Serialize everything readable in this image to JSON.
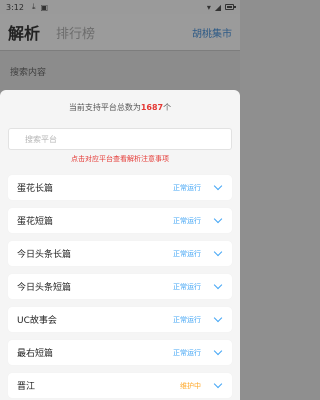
{
  "status_bar": {
    "time": "3:12"
  },
  "background": {
    "tabs": [
      "解析",
      "排行榜"
    ],
    "link_label": "胡桃集市",
    "search_label": "搜索内容"
  },
  "sheet": {
    "count_prefix": "当前支持平台总数为",
    "count_value": "1687",
    "count_suffix": "个",
    "search_placeholder": "搜索平台",
    "notice": "点击对应平台查看解析注意事项",
    "platforms": [
      {
        "name": "蛋花长篇",
        "status": "正常运行"
      },
      {
        "name": "蛋花短篇",
        "status": "正常运行"
      },
      {
        "name": "今日头条长篇",
        "status": "正常运行"
      },
      {
        "name": "今日头条短篇",
        "status": "正常运行"
      },
      {
        "name": "UC故事会",
        "status": "正常运行"
      },
      {
        "name": "最右短篇",
        "status": "正常运行"
      },
      {
        "name": "晋江",
        "status": "维护中"
      }
    ]
  },
  "colors": {
    "accent": "#42a5f5",
    "warning": "#ffa726",
    "highlight": "#e53935"
  }
}
